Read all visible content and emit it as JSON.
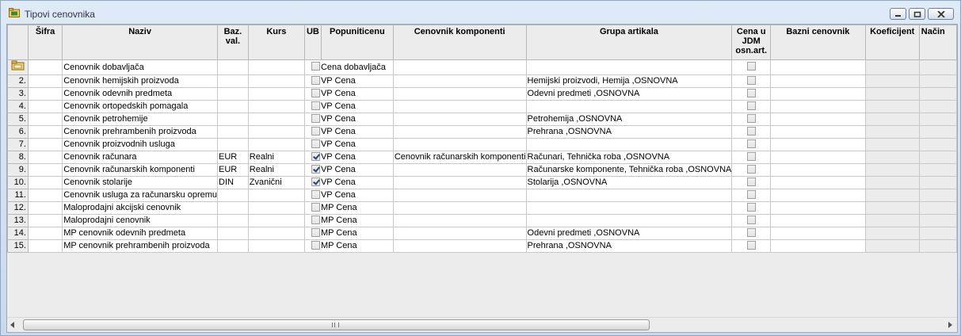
{
  "window": {
    "title": "Tipovi cenovnika"
  },
  "columns": [
    "",
    "Šifra",
    "Naziv",
    "Baz. val.",
    "Kurs",
    "UB",
    "Popuniticenu",
    "Cenovnik komponenti",
    "Grupa artikala",
    "Cena u JDM osn.art.",
    "Bazni cenovnik",
    "Koeficijent",
    "Način"
  ],
  "rows": [
    {
      "rn": "",
      "naziv": "Cenovnik dobavljača",
      "val": "",
      "kurs": "",
      "ub": false,
      "pop": "Cena dobavljača",
      "komp": "",
      "grupa": ""
    },
    {
      "rn": "2.",
      "naziv": "Cenovnik hemijskih proizvoda",
      "val": "",
      "kurs": "",
      "ub": false,
      "pop": "VP Cena",
      "komp": "",
      "grupa": "Hemijski proizvodi, Hemija ,OSNOVNA"
    },
    {
      "rn": "3.",
      "naziv": "Cenovnik odevnih predmeta",
      "val": "",
      "kurs": "",
      "ub": false,
      "pop": "VP Cena",
      "komp": "",
      "grupa": "Odevni predmeti ,OSNOVNA"
    },
    {
      "rn": "4.",
      "naziv": "Cenovnik ortopedskih pomagala",
      "val": "",
      "kurs": "",
      "ub": false,
      "pop": "VP Cena",
      "komp": "",
      "grupa": ""
    },
    {
      "rn": "5.",
      "naziv": "Cenovnik petrohemije",
      "val": "",
      "kurs": "",
      "ub": false,
      "pop": "VP Cena",
      "komp": "",
      "grupa": "Petrohemija ,OSNOVNA"
    },
    {
      "rn": "6.",
      "naziv": "Cenovnik prehrambenih proizvoda",
      "val": "",
      "kurs": "",
      "ub": false,
      "pop": "VP Cena",
      "komp": "",
      "grupa": "Prehrana ,OSNOVNA"
    },
    {
      "rn": "7.",
      "naziv": "Cenovnik proizvodnih usluga",
      "val": "",
      "kurs": "",
      "ub": false,
      "pop": "VP Cena",
      "komp": "",
      "grupa": ""
    },
    {
      "rn": "8.",
      "naziv": "Cenovnik računara",
      "val": "EUR",
      "kurs": "Realni",
      "ub": true,
      "pop": "VP Cena",
      "komp": "Cenovnik računarskih komponenti",
      "grupa": "Računari, Tehnička roba ,OSNOVNA"
    },
    {
      "rn": "9.",
      "naziv": "Cenovnik računarskih komponenti",
      "val": "EUR",
      "kurs": "Realni",
      "ub": true,
      "pop": "VP Cena",
      "komp": "",
      "grupa": "Računarske komponente, Tehnička roba ,OSNOVNA"
    },
    {
      "rn": "10.",
      "naziv": "Cenovnik stolarije",
      "val": "DIN",
      "kurs": "Zvanični",
      "ub": true,
      "pop": "VP Cena",
      "komp": "",
      "grupa": "Stolarija ,OSNOVNA"
    },
    {
      "rn": "11.",
      "naziv": "Cenovnik usluga za računarsku opremu",
      "val": "",
      "kurs": "",
      "ub": false,
      "pop": "VP Cena",
      "komp": "",
      "grupa": ""
    },
    {
      "rn": "12.",
      "naziv": "Maloprodajni akcijski cenovnik",
      "val": "",
      "kurs": "",
      "ub": false,
      "pop": "MP Cena",
      "komp": "",
      "grupa": ""
    },
    {
      "rn": "13.",
      "naziv": "Maloprodajni cenovnik",
      "val": "",
      "kurs": "",
      "ub": false,
      "pop": "MP Cena",
      "komp": "",
      "grupa": ""
    },
    {
      "rn": "14.",
      "naziv": "MP cenovnik odevnih predmeta",
      "val": "",
      "kurs": "",
      "ub": false,
      "pop": "MP Cena",
      "komp": "",
      "grupa": "Odevni predmeti ,OSNOVNA"
    },
    {
      "rn": "15.",
      "naziv": "MP cenovnik prehrambenih proizvoda",
      "val": "",
      "kurs": "",
      "ub": false,
      "pop": "MP Cena",
      "komp": "",
      "grupa": "Prehrana ,OSNOVNA"
    }
  ],
  "scrollbar": {
    "grip": "III"
  }
}
